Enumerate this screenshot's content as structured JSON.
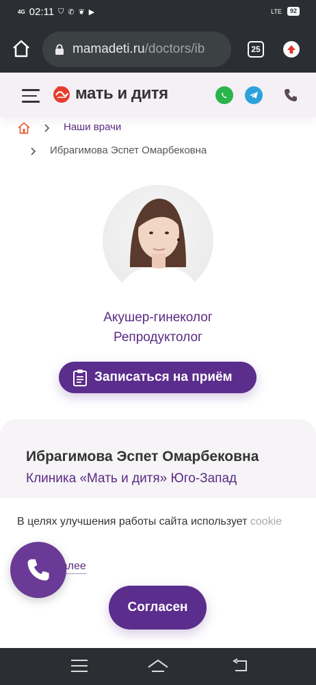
{
  "status_bar": {
    "network": "4G",
    "time": "02:11",
    "lte": "LTE",
    "battery": "92"
  },
  "browser": {
    "url_domain": "mamadeti.ru",
    "url_path": "/doctors/ib",
    "tab_count": "25"
  },
  "header": {
    "logo_text": "мать и дитя",
    "colors": {
      "brand": "#e63c2c",
      "accent": "#5b2d8c",
      "whatsapp": "#2bb44b",
      "telegram": "#2ca2dc"
    }
  },
  "breadcrumbs": {
    "link_label": "Наши врачи",
    "current": "Ибрагимова Эспет Омарбековна"
  },
  "doctor": {
    "specialty_1": "Акушер-гинеколог",
    "specialty_2": "Репродуктолог",
    "book_label": "Записаться на приём",
    "name": "Ибрагимова Эспет Омарбековна",
    "clinic": "Клиника «Мать и дитя» Юго-Запад"
  },
  "cookie": {
    "text_main": "В целях улучшения работы сайта использует",
    "text_faded": "cookie",
    "read_more": "Читать далее",
    "agree_label": "Согласен"
  },
  "icons": [
    "home-icon",
    "lock-icon",
    "tabs-icon",
    "update-icon",
    "burger-icon",
    "whatsapp-icon",
    "telegram-icon",
    "phone-icon",
    "clipboard-icon",
    "chevron-right-icon",
    "nav-menu-icon",
    "nav-home-icon",
    "nav-back-icon"
  ]
}
